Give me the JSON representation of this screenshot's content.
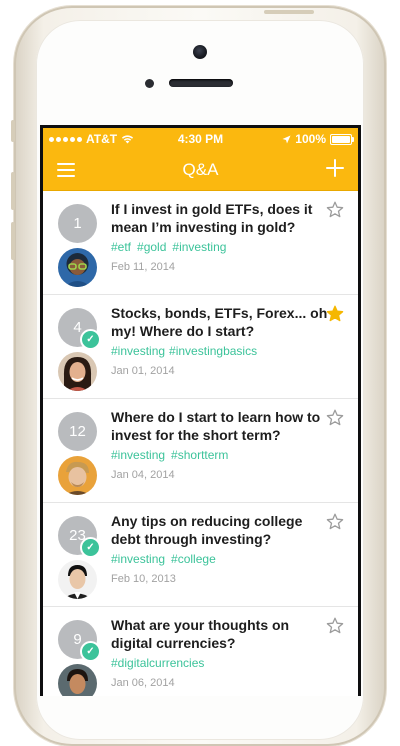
{
  "statusbar": {
    "carrier": "AT&T",
    "time": "4:30 PM",
    "battery": "100%"
  },
  "navbar": {
    "title": "Q&A",
    "menu_icon": "hamburger-menu-icon",
    "add_icon": "plus-icon"
  },
  "colors": {
    "brand": "#fbb80f",
    "tag": "#3cc39a",
    "badge": "#b9bbbe",
    "star_active": "#f5b700"
  },
  "questions": [
    {
      "count": "1",
      "answered": false,
      "title": "If I invest in gold ETFs, does it mean I’m investing in gold?",
      "tags": [
        "#etf",
        "#gold",
        "#investing"
      ],
      "date": "Feb 11, 2014",
      "starred": false
    },
    {
      "count": "4",
      "answered": true,
      "title": "Stocks, bonds, ETFs, Forex... oh my! Where do I start?",
      "tags": [
        "#investing",
        "#investingbasics"
      ],
      "date": "Jan 01, 2014",
      "starred": true
    },
    {
      "count": "12",
      "answered": false,
      "title": "Where do I start to learn how to invest for the short term?",
      "tags": [
        "#investing",
        "#shortterm"
      ],
      "date": "Jan 04, 2014",
      "starred": false
    },
    {
      "count": "23",
      "answered": true,
      "title": "Any tips on reducing college debt through investing?",
      "tags": [
        "#investing",
        "#college"
      ],
      "date": "Feb 10, 2013",
      "starred": false
    },
    {
      "count": "9",
      "answered": true,
      "title": "What are your thoughts on digital currencies?",
      "tags": [
        "#digitalcurrencies"
      ],
      "date": "Jan 06, 2014",
      "starred": false
    }
  ]
}
